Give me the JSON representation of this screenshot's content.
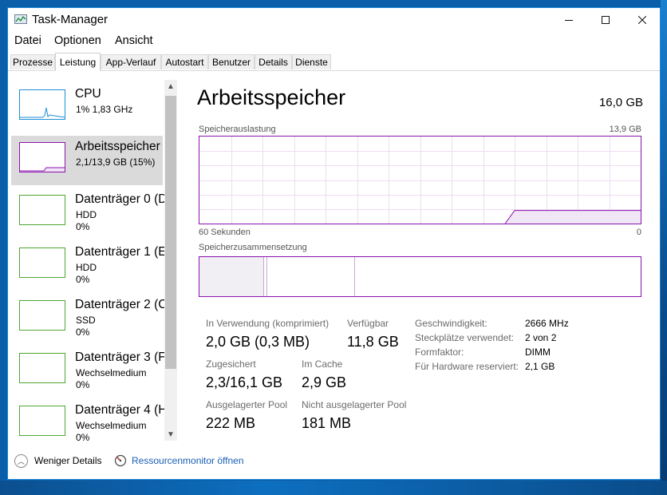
{
  "window": {
    "title": "Task-Manager"
  },
  "menu": [
    "Datei",
    "Optionen",
    "Ansicht"
  ],
  "tabs": [
    "Prozesse",
    "Leistung",
    "App-Verlauf",
    "Autostart",
    "Benutzer",
    "Details",
    "Dienste"
  ],
  "active_tab": "Leistung",
  "sidebar": {
    "items": [
      {
        "name": "CPU",
        "line1": "1% 1,83 GHz",
        "line2": "",
        "accent": "#1a8fd6",
        "icon": "cpu-graph"
      },
      {
        "name": "Arbeitsspeicher",
        "line1": "2,1/13,9 GB (15%)",
        "line2": "",
        "accent": "#8b12ae",
        "icon": "memory-graph"
      },
      {
        "name": "Datenträger 0 (D",
        "line1": "HDD",
        "line2": "0%",
        "accent": "#4ea72e",
        "icon": "disk-graph"
      },
      {
        "name": "Datenträger 1 (E",
        "line1": "HDD",
        "line2": "0%",
        "accent": "#4ea72e",
        "icon": "disk-graph"
      },
      {
        "name": "Datenträger 2 (C",
        "line1": "SSD",
        "line2": "0%",
        "accent": "#4ea72e",
        "icon": "disk-graph"
      },
      {
        "name": "Datenträger 3 (F",
        "line1": "Wechselmedium",
        "line2": "0%",
        "accent": "#4ea72e",
        "icon": "disk-graph"
      },
      {
        "name": "Datenträger 4 (H",
        "line1": "Wechselmedium",
        "line2": "0%",
        "accent": "#4ea72e",
        "icon": "disk-graph"
      }
    ]
  },
  "detail": {
    "title": "Arbeitsspeicher",
    "total": "16,0 GB",
    "usage_label": "Speicherauslastung",
    "usage_max": "13,9 GB",
    "time_label": "60 Sekunden",
    "time_min": "0",
    "composition_label": "Speicherzusammensetzung",
    "usage_history_fraction": [
      0,
      0,
      0,
      0,
      0,
      0,
      0,
      0,
      0,
      0,
      0.15,
      0.15,
      0.15,
      0.15,
      0.15
    ],
    "stats": {
      "in_use_label": "In Verwendung (komprimiert)",
      "in_use_value": "2,0 GB (0,3 MB)",
      "available_label": "Verfügbar",
      "available_value": "11,8 GB",
      "committed_label": "Zugesichert",
      "committed_value": "2,3/16,1 GB",
      "cached_label": "Im Cache",
      "cached_value": "2,9 GB",
      "paged_label": "Ausgelagerter Pool",
      "paged_value": "222 MB",
      "nonpaged_label": "Nicht ausgelagerter Pool",
      "nonpaged_value": "181 MB"
    },
    "specs": [
      {
        "key": "Geschwindigkeit:",
        "value": "2666 MHz"
      },
      {
        "key": "Steckplätze verwendet:",
        "value": "2 von 2"
      },
      {
        "key": "Formfaktor:",
        "value": "DIMM"
      },
      {
        "key": "Für Hardware reserviert:",
        "value": "2,1 GB"
      }
    ]
  },
  "footer": {
    "fewer_details": "Weniger Details",
    "resource_monitor": "Ressourcenmonitor öffnen"
  },
  "colors": {
    "memory": "#8b12ae",
    "cpu": "#1a8fd6",
    "disk": "#4ea72e",
    "accent": "#1883d7"
  }
}
